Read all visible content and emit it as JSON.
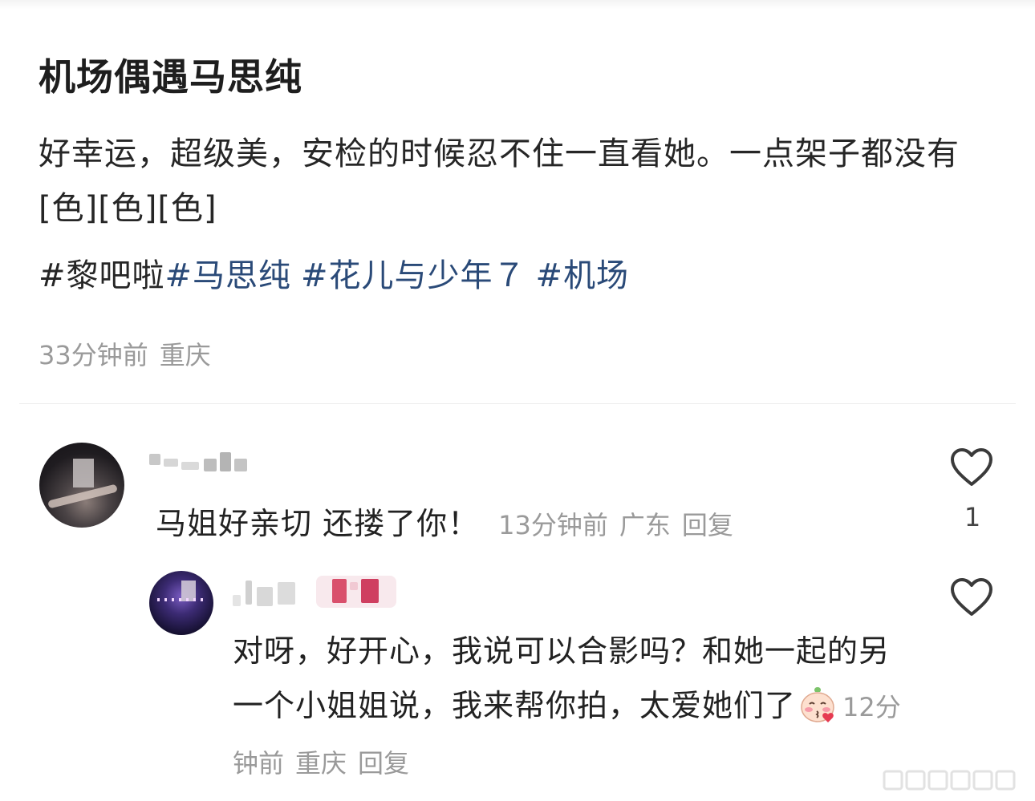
{
  "post": {
    "title": "机场偶遇马思纯",
    "body": "好幸运，超级美，安检的时候忍不住一直看她。一点架子都没有[色][色][色]",
    "hashtags": [
      "#黎吧啦",
      "#马思纯",
      "#花儿与少年７",
      "#机场"
    ],
    "time": "33分钟前",
    "location": "重庆"
  },
  "comments": [
    {
      "text": "马姐好亲切 还搂了你！",
      "time": "13分钟前",
      "location": "广东",
      "reply_label": "回复",
      "likes": "1"
    }
  ],
  "reply": {
    "text_main": "对呀，好开心，我说可以合影吗？和她一起的另一个小姐姐说，我来帮你拍，太爱她们了",
    "emoji": "blush-kiss-emoji",
    "time": "12分钟前",
    "location": "重庆",
    "reply_label": "回复"
  },
  "colors": {
    "hashtag": "#2a4a78",
    "meta": "#9a9a9a",
    "author_badge": "#d9506c"
  },
  "icons": [
    "heart-outline-icon",
    "heart-outline-icon",
    "blush-kiss-emoji"
  ]
}
